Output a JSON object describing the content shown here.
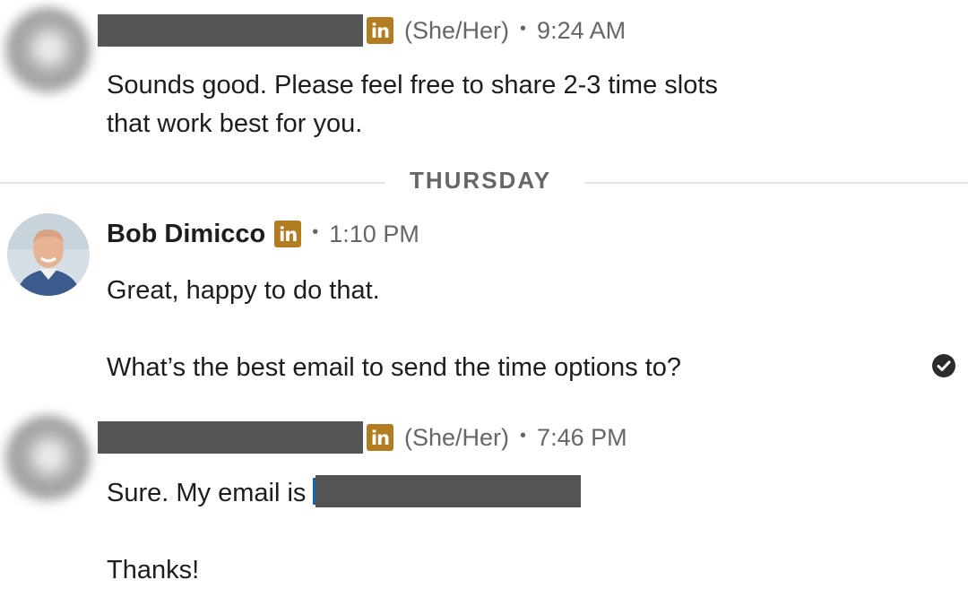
{
  "messages": [
    {
      "sender": "",
      "pronouns": "(She/Her)",
      "separator": "•",
      "time": "9:24 AM",
      "body": [
        "Sounds good. Please feel free to share 2-3 time slots",
        "that work best for you."
      ]
    },
    {
      "sender": "Bob Dimicco",
      "separator": "•",
      "time": "1:10 PM",
      "body": [
        "Great, happy to do that.",
        "What’s the best email to send the time options to?"
      ],
      "status_icon": "read-receipt-check-icon"
    },
    {
      "sender": "",
      "pronouns": "(She/Her)",
      "separator": "•",
      "time": "7:46 PM",
      "body": [
        "Sure. My email is",
        "Thanks!"
      ]
    }
  ],
  "day_divider": "THURSDAY",
  "badge": {
    "text": "in",
    "color": "#b27c22",
    "icon": "linkedin-icon"
  },
  "colors": {
    "redaction": "#555555",
    "link": "#0a66c2",
    "muted_text": "#666666"
  }
}
